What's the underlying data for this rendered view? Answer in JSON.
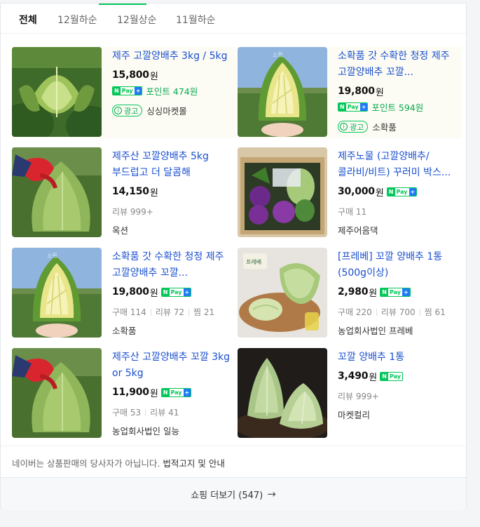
{
  "tabs": [
    {
      "label": "전체",
      "active": true
    },
    {
      "label": "12월하순",
      "active": false
    },
    {
      "label": "12월상순",
      "active": false
    },
    {
      "label": "11월하순",
      "active": false
    }
  ],
  "npay": {
    "n": "N",
    "pay": "Pay",
    "plus": "+"
  },
  "ad_badge": {
    "icon": "i",
    "label": "광고"
  },
  "won": "원",
  "products": [
    {
      "title": "제주 고깔양배추 3kg / 5kg",
      "price": "15,800",
      "point_label": "포인트 474원",
      "seller": "싱싱마켓몰",
      "image": "cabbage-field-icon"
    },
    {
      "title": "소확품 갓 수확한 청정 제주 고깔양배추 꼬깔...",
      "price": "19,800",
      "point_label": "포인트 594원",
      "seller": "소확품",
      "image": "cabbage-cut-icon"
    },
    {
      "title": "제주산 꼬깔양배추 5kg 부드럽고 더 달콤해",
      "price": "14,150",
      "meta": [
        "리뷰 999+"
      ],
      "seller": "옥션",
      "image": "cabbage-glove-icon"
    },
    {
      "title": "제주노물 (고깔양배추/콜라비/비트) 꾸러미 박스...",
      "price": "30,000",
      "meta": [
        "구매 11"
      ],
      "seller": "제주어음댁",
      "image": "vegetable-box-icon"
    },
    {
      "title": "소확품 갓 수확한 청정 제주 고깔양배추 꼬깔...",
      "price": "19,800",
      "meta": [
        "구매 114",
        "리뷰 72",
        "찜 21"
      ],
      "seller": "소확품",
      "image": "cabbage-cut-icon"
    },
    {
      "title": "[프레베] 꼬깔 양배추 1통(500g이상)",
      "price": "2,980",
      "meta": [
        "구매 220",
        "리뷰 700",
        "찜 61"
      ],
      "seller": "농업회사법인 프레베",
      "image": "cabbage-board-icon"
    },
    {
      "title": "제주산 고깔양배추 꼬깔 3kg or 5kg",
      "price": "11,900",
      "meta": [
        "구매 53",
        "리뷰 41"
      ],
      "seller": "농업회사법인 일능",
      "image": "cabbage-glove-icon"
    },
    {
      "title": "꼬깔 양배추 1통",
      "price": "3,490",
      "meta": [
        "리뷰 999+"
      ],
      "seller": "마켓컬리",
      "image": "cabbage-dark-icon"
    }
  ],
  "disclaimer": {
    "text": "네이버는 상품판매의 당사자가 아닙니다. ",
    "link": "법적고지 및 안내"
  },
  "more": {
    "label": "쇼핑 더보기 (547)",
    "arrow": "→"
  },
  "colors": {
    "accent": "#03c75a",
    "link": "#1a4fcf",
    "point": "#03a94f"
  }
}
